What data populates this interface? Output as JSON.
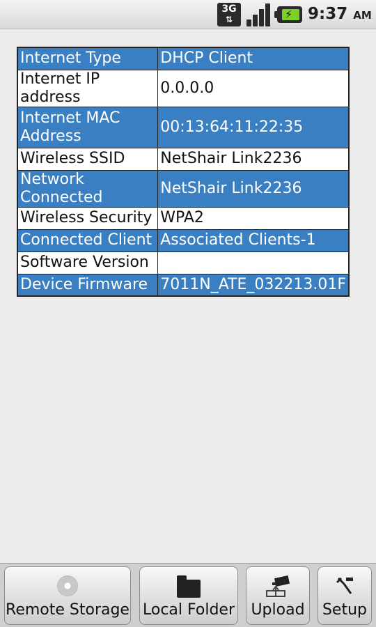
{
  "status_bar": {
    "network": "3G",
    "network_arrows": "⇅",
    "time": "9:37",
    "ampm": "AM",
    "icons": [
      "3g-data-icon",
      "signal-strength-icon",
      "battery-charging-icon"
    ]
  },
  "info_table": {
    "rows": [
      {
        "label": "Internet Type",
        "value": "DHCP Client"
      },
      {
        "label": "Internet IP address",
        "value": "0.0.0.0"
      },
      {
        "label": "Internet MAC Address",
        "value": "00:13:64:11:22:35"
      },
      {
        "label": "Wireless SSID",
        "value": "NetShair Link2236"
      },
      {
        "label": "Network Connected",
        "value": "NetShair Link2236"
      },
      {
        "label": "Wireless Security",
        "value": "WPA2"
      },
      {
        "label": "Connected Client",
        "value": "Associated Clients-1"
      },
      {
        "label": "Software Version",
        "value": ""
      },
      {
        "label": "Device Firmware",
        "value": "7011N_ATE_032213.01F"
      }
    ]
  },
  "bottom_bar": {
    "remote_storage": "Remote Storage",
    "local_folder": "Local Folder",
    "upload": "Upload",
    "setup": "Setup"
  },
  "colors": {
    "row_highlight": "#3a7fc1",
    "row_plain": "#ffffff",
    "background": "#ececec"
  }
}
